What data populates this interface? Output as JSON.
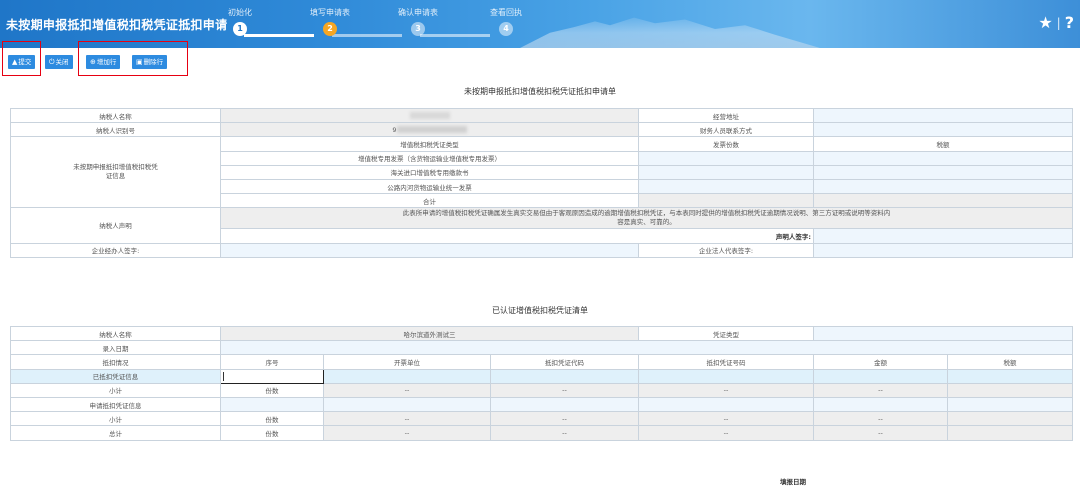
{
  "header": {
    "title": "未按期申报抵扣增值税扣税凭证抵扣申请",
    "steps": [
      {
        "label": "初始化",
        "num": "1"
      },
      {
        "label": "填写申请表",
        "num": "2"
      },
      {
        "label": "确认申请表",
        "num": "3"
      },
      {
        "label": "查看回执",
        "num": "4"
      }
    ],
    "star_icon": "★",
    "separator": "|",
    "help_icon": "?"
  },
  "toolbar": {
    "submit_label": "提交",
    "close_label": "关闭",
    "add_row_label": "增加行",
    "delete_row_label": "删除行",
    "accent_color": "#2d8be0",
    "highlight_color": "#e60012"
  },
  "form1": {
    "title": "未按期申报抵扣增值税扣税凭证抵扣申请单",
    "taxpayer_name_label": "纳税人名称",
    "business_address_label": "经营地址",
    "taxpayer_id_label": "纳税人识别号",
    "taxpayer_id_prefix": "9",
    "finance_contact_label": "财务人员联系方式",
    "voucher_info_label": "未按期申报抵扣增值税扣税凭证信息",
    "voucher_type_label": "增值税扣税凭证类型",
    "invoice_count_label": "发票份数",
    "tax_amount_label": "税额",
    "voucher_types": [
      "增值税专用发票（含货物运输业增值税专用发票）",
      "海关进口增值税专用缴款书",
      "公路内河货物运输业统一发票",
      "合计"
    ],
    "declaration_label": "纳税人声明",
    "declaration_text": "此表所申请的增值税扣税凭证确属发生真实交易但由于客观原因造成的逾期增值税扣税凭证，与本表同时提供的增值税扣税凭证逾期情况说明、第三方证明或说明等资料内容是真实、可靠的。",
    "declarant_signature_label": "声明人签字:",
    "agent_signature_label": "企业经办人签字:",
    "legal_rep_signature_label": "企业法人代表签字:"
  },
  "form2": {
    "title": "已认证增值税扣税凭证清单",
    "taxpayer_name_label": "纳税人名称",
    "taxpayer_name_value": "哈尔滨道外测试三",
    "voucher_type_label": "凭证类型",
    "entry_date_label": "录入日期",
    "deduction_status_label": "抵扣情况",
    "columns": [
      "序号",
      "开票单位",
      "抵扣凭证代码",
      "抵扣凭证号码",
      "金额",
      "税额"
    ],
    "rows": [
      {
        "label": "已抵扣凭证信息"
      },
      {
        "label": "小计",
        "count_label": "份数",
        "dash": "--"
      },
      {
        "label": "申请抵扣凭证信息"
      },
      {
        "label": "小计",
        "count_label": "份数",
        "dash": "--"
      },
      {
        "label": "总计",
        "count_label": "份数",
        "dash": "--"
      }
    ],
    "fill_date_label": "填报日期"
  }
}
